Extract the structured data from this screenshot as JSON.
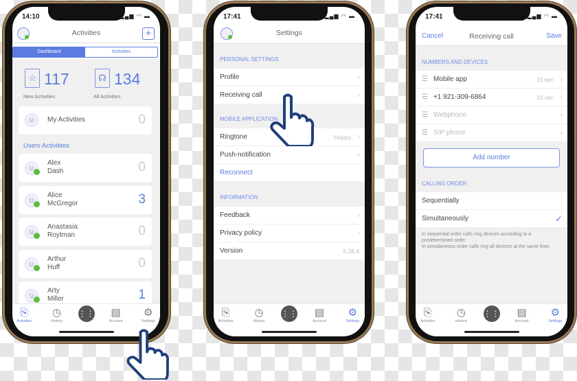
{
  "colors": {
    "accent": "#5b7be0",
    "online": "#5cbd3a",
    "background": "#f0f0f0"
  },
  "tabbar": {
    "items": [
      {
        "label": "Activities",
        "icon": "clipboard-icon"
      },
      {
        "label": "History",
        "icon": "clock-icon"
      },
      {
        "label": "",
        "icon": "dialpad-icon"
      },
      {
        "label": "Account",
        "icon": "contact-card-icon"
      },
      {
        "label": "Settings",
        "icon": "gear-icon"
      }
    ]
  },
  "phone1": {
    "time": "14:10",
    "title": "Activities",
    "segments": [
      "Dashboard",
      "Activities"
    ],
    "active_segment": 0,
    "stats": [
      {
        "value": "117",
        "label": "New Activities",
        "icon": "clipboard-star-icon"
      },
      {
        "value": "134",
        "label": "All Activities",
        "icon": "clipboard-headset-icon"
      }
    ],
    "my_activities": {
      "label": "My Activities",
      "count": "0"
    },
    "users_title": "Users Activitites",
    "users": [
      {
        "first": "Alex",
        "last": "Dash",
        "count": "0"
      },
      {
        "first": "Alice",
        "last": "McGregor",
        "count": "3"
      },
      {
        "first": "Anastasia",
        "last": "Roytman",
        "count": "0"
      },
      {
        "first": "Arthur",
        "last": "Huff",
        "count": "0"
      },
      {
        "first": "Arty",
        "last": "Miller",
        "count": "1"
      }
    ],
    "active_tab": 0
  },
  "phone2": {
    "time": "17:41",
    "title": "Settings",
    "sections": [
      {
        "title": "PERSONAL SETTINGS",
        "rows": [
          {
            "label": "Profile",
            "chevron": true
          },
          {
            "label": "Receiving call",
            "chevron": true
          }
        ]
      },
      {
        "title": "MOBILE APPLICATION",
        "rows": [
          {
            "label": "Ringtone",
            "value": "Happy",
            "chevron": true
          },
          {
            "label": "Push-notification",
            "chevron": true
          },
          {
            "label": "Reconnect",
            "link": true
          }
        ]
      },
      {
        "title": "INFORMATION",
        "rows": [
          {
            "label": "Feedback",
            "chevron": true
          },
          {
            "label": "Privacy policy",
            "chevron": true
          },
          {
            "label": "Version",
            "value": "5.28.4"
          }
        ]
      }
    ],
    "active_tab": 4
  },
  "phone3": {
    "time": "17:41",
    "cancel": "Cancel",
    "title": "Receiving call",
    "save": "Save",
    "numbers_title": "NUMBERS AND DEVICES",
    "devices": [
      {
        "label": "Mobile app",
        "value": "15 sec",
        "enabled": true
      },
      {
        "label": "+1 921-309-6864",
        "value": "15 sec",
        "enabled": true
      },
      {
        "label": "Webphone",
        "enabled": false
      },
      {
        "label": "SIP phone",
        "enabled": false
      }
    ],
    "add_number": "Add number",
    "order_title": "CALLING ORDER",
    "orders": [
      {
        "label": "Sequentially",
        "selected": false
      },
      {
        "label": "Simultaneously",
        "selected": true
      }
    ],
    "description": [
      "In sequential order calls ring devices according to a predetermined order.",
      "In simultaneous order calls ring all devices at the same time."
    ],
    "active_tab": 4
  }
}
